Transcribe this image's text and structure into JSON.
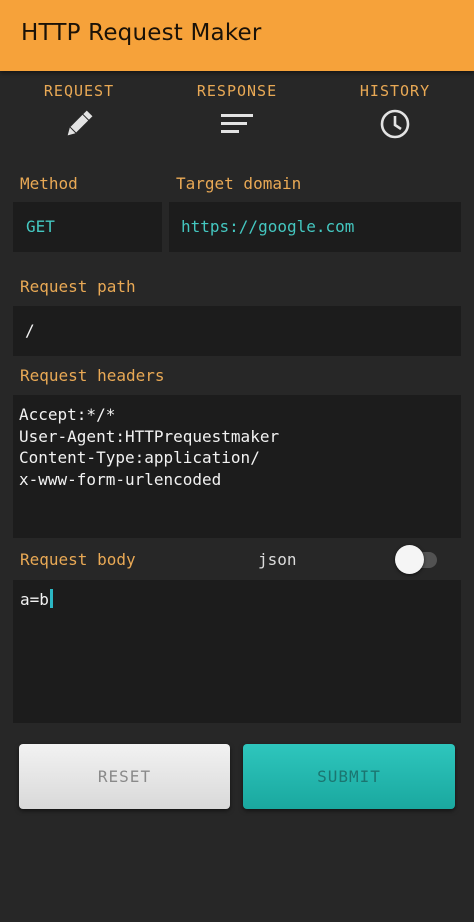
{
  "app": {
    "title": "HTTP Request Maker",
    "accent_color": "#f6a23a",
    "label_color": "#e9a955",
    "value_color": "#44c7c0"
  },
  "tabs": [
    {
      "label": "REQUEST",
      "icon": "pencil-icon"
    },
    {
      "label": "RESPONSE",
      "icon": "lines-icon"
    },
    {
      "label": "HISTORY",
      "icon": "clock-icon"
    }
  ],
  "form": {
    "method_label": "Method",
    "method_value": "GET",
    "target_label": "Target domain",
    "target_value": "https://google.com",
    "path_label": "Request path",
    "path_value": "/",
    "headers_label": "Request headers",
    "headers_value": "Accept:*/*\nUser-Agent:HTTPrequestmaker\nContent-Type:application/\nx-www-form-urlencoded",
    "body_label": "Request body",
    "json_label": "json",
    "json_enabled": false,
    "body_value": "a=b"
  },
  "buttons": {
    "reset_label": "RESET",
    "submit_label": "SUBMIT"
  }
}
